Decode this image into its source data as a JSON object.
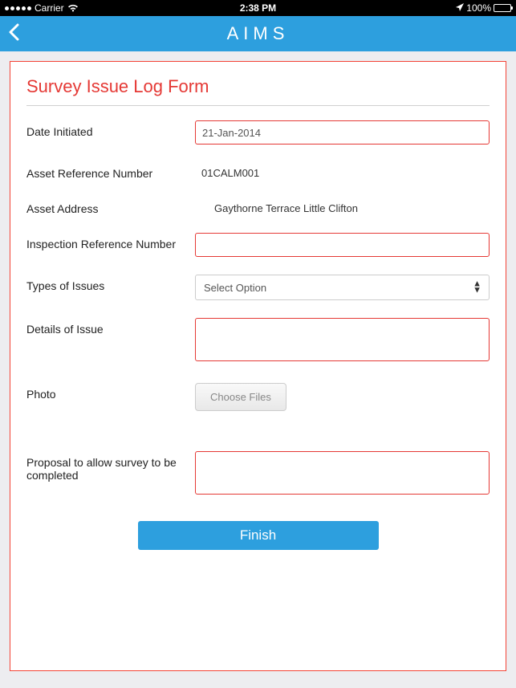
{
  "status": {
    "carrier": "Carrier",
    "time": "2:38 PM",
    "battery_pct": "100%"
  },
  "nav": {
    "title": "AIMS"
  },
  "form": {
    "title": "Survey Issue Log Form",
    "labels": {
      "date_initiated": "Date Initiated",
      "asset_ref": "Asset Reference Number",
      "asset_address": "Asset Address",
      "inspection_ref": "Inspection Reference Number",
      "issue_types": "Types of Issues",
      "issue_details": "Details of Issue",
      "photo": "Photo",
      "proposal": "Proposal to allow survey to be completed"
    },
    "values": {
      "date_initiated": "21-Jan-2014",
      "asset_ref": "01CALM001",
      "asset_address": "Gaythorne Terrace Little Clifton",
      "inspection_ref": "",
      "issue_types_placeholder": "Select Option",
      "issue_details": "",
      "photo_button": "Choose Files",
      "proposal": ""
    },
    "finish_label": "Finish"
  }
}
